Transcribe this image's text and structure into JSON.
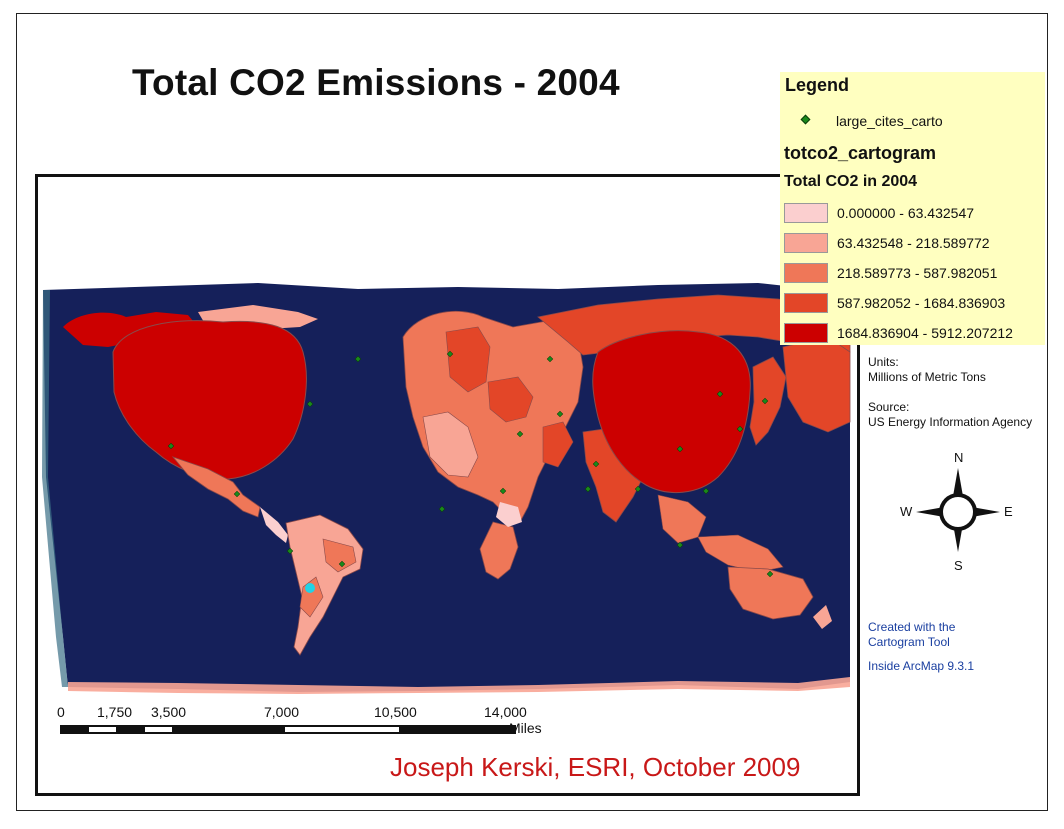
{
  "title": "Total CO2 Emissions - 2004",
  "legend": {
    "heading": "Legend",
    "cities_label": "large_cites_carto",
    "layer_name": "totco2_cartogram",
    "field_name": "Total CO2 in 2004",
    "classes": [
      {
        "label": "0.000000 - 63.432547",
        "color": "#fbcfcf"
      },
      {
        "label": "63.432548 - 218.589772",
        "color": "#f8a595"
      },
      {
        "label": "218.589773 - 587.982051",
        "color": "#ef7758"
      },
      {
        "label": "587.982052 - 1684.836903",
        "color": "#e34628"
      },
      {
        "label": "1684.836904 - 5912.207212",
        "color": "#cc0000"
      }
    ]
  },
  "units": {
    "heading": "Units:",
    "value": "Millions of Metric Tons"
  },
  "source": {
    "heading": "Source:",
    "value": "US Energy Information Agency"
  },
  "compass": {
    "n": "N",
    "s": "S",
    "e": "E",
    "w": "W"
  },
  "created": {
    "line1": "Created with the",
    "line2": "Cartogram Tool",
    "line3": "Inside ArcMap 9.3.1"
  },
  "scalebar": {
    "ticks": [
      "0",
      "1,750",
      "3,500",
      "7,000",
      "10,500",
      "14,000"
    ],
    "units": "Miles"
  },
  "credit": "Joseph Kerski, ESRI, October 2009",
  "colors": {
    "ocean": "#15205a",
    "legend_bg": "#ffffc0",
    "credit": "#c81818",
    "highlight_dot": "#22d3e6"
  }
}
